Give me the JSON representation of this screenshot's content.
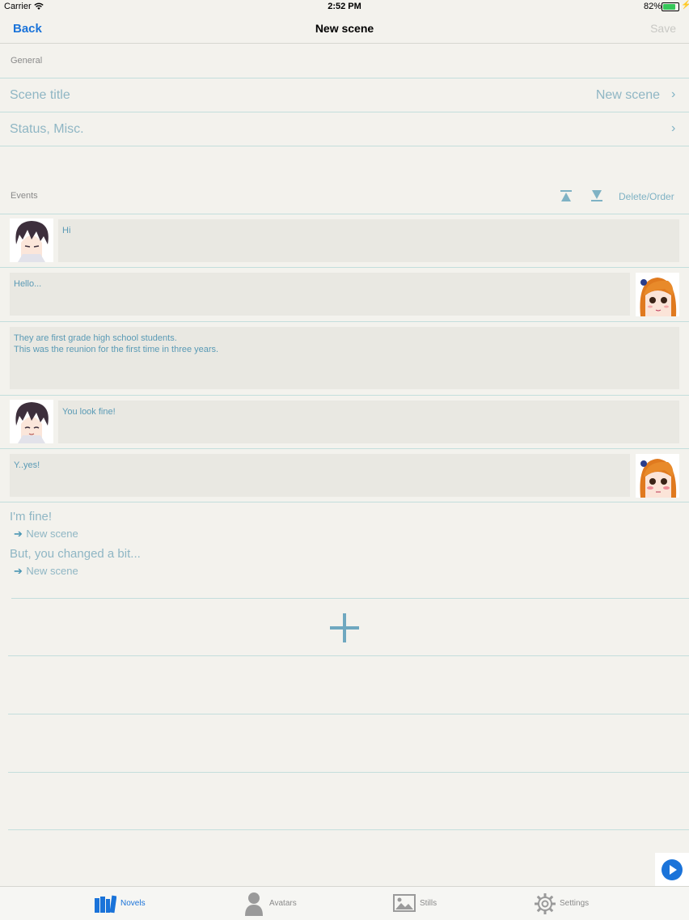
{
  "status": {
    "carrier": "Carrier",
    "time": "2:52 PM",
    "battery": "82%",
    "battery_level": 0.82
  },
  "nav": {
    "back": "Back",
    "title": "New scene",
    "save": "Save"
  },
  "general": {
    "header": "General",
    "rows": [
      {
        "label": "Scene title",
        "value": "New scene"
      },
      {
        "label": "Status, Misc.",
        "value": ""
      }
    ]
  },
  "events": {
    "header": "Events",
    "delete_order": "Delete/Order",
    "items": [
      {
        "speaker": "male",
        "side": "left",
        "text": "Hi"
      },
      {
        "speaker": "female",
        "side": "right",
        "text": "Hello..."
      },
      {
        "speaker": "narration",
        "side": "none",
        "text": "They are first grade high school students.\nThis was the reunion for the first time in three years."
      },
      {
        "speaker": "male",
        "side": "left",
        "text": "You look fine!"
      },
      {
        "speaker": "female",
        "side": "right",
        "text": "Y..yes!"
      }
    ],
    "choices": [
      {
        "text": "I'm fine!",
        "link": "New scene"
      },
      {
        "text": "But, you changed a bit...",
        "link": "New scene"
      }
    ]
  },
  "colors": {
    "accent": "#1a73d9",
    "teal": "#8fb6c4",
    "background": "#f3f2ed"
  },
  "tabs": [
    {
      "label": "Novels",
      "icon": "books-icon",
      "active": true
    },
    {
      "label": "Avatars",
      "icon": "person-icon",
      "active": false
    },
    {
      "label": "Stills",
      "icon": "image-icon",
      "active": false
    },
    {
      "label": "Settings",
      "icon": "gear-icon",
      "active": false
    }
  ]
}
